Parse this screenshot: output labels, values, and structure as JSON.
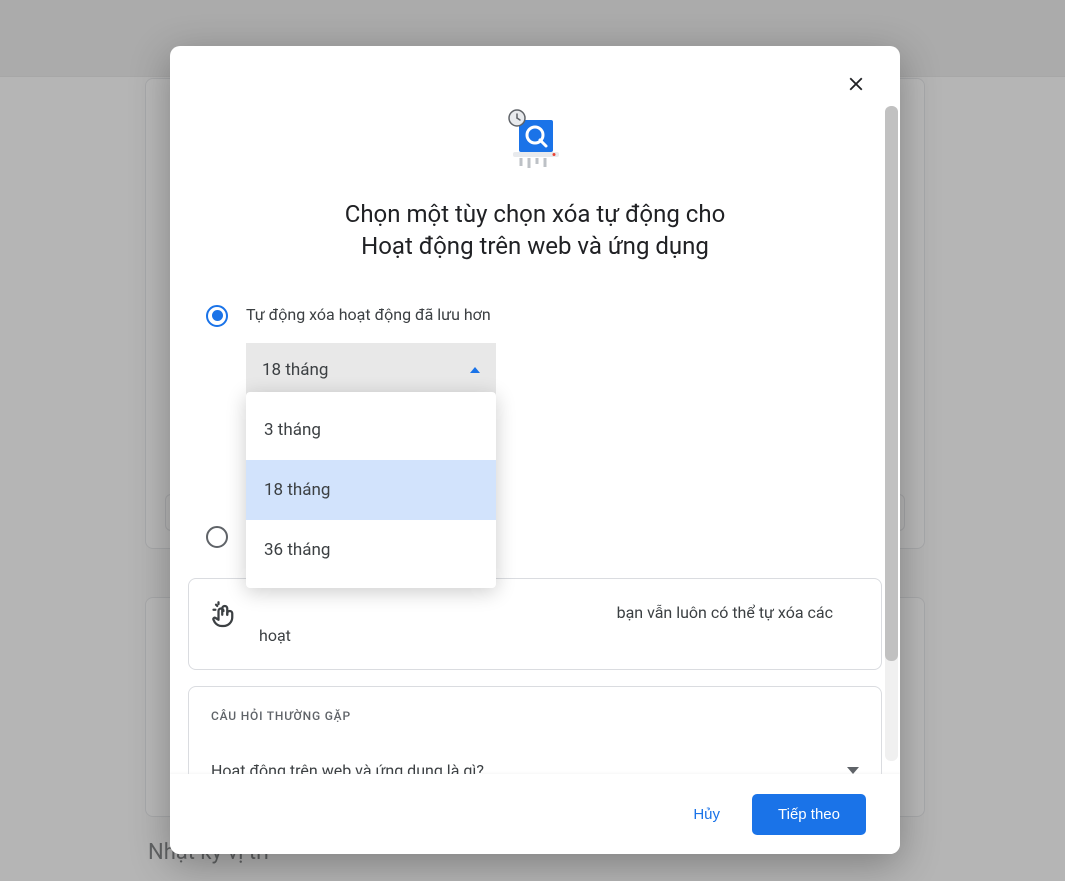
{
  "background": {
    "section_title": "Nhật ký vị trí"
  },
  "dialog": {
    "title_line1": "Chọn một tùy chọn xóa tự động cho",
    "title_line2": "Hoạt động trên web và ứng dụng",
    "option1_label": "Tự động xóa hoạt động đã lưu hơn",
    "select_value": "18 tháng",
    "dropdown": [
      "3 tháng",
      "18 tháng",
      "36 tháng"
    ],
    "dropdown_selected_index": 1,
    "info_text_right": "bạn vẫn luôn có thể tự xóa các hoạt",
    "faq_heading": "CÂU HỎI THƯỜNG GẶP",
    "faq_q1": "Hoạt động trên web và ứng dụng là gì?",
    "footer": {
      "cancel": "Hủy",
      "next": "Tiếp theo"
    }
  }
}
